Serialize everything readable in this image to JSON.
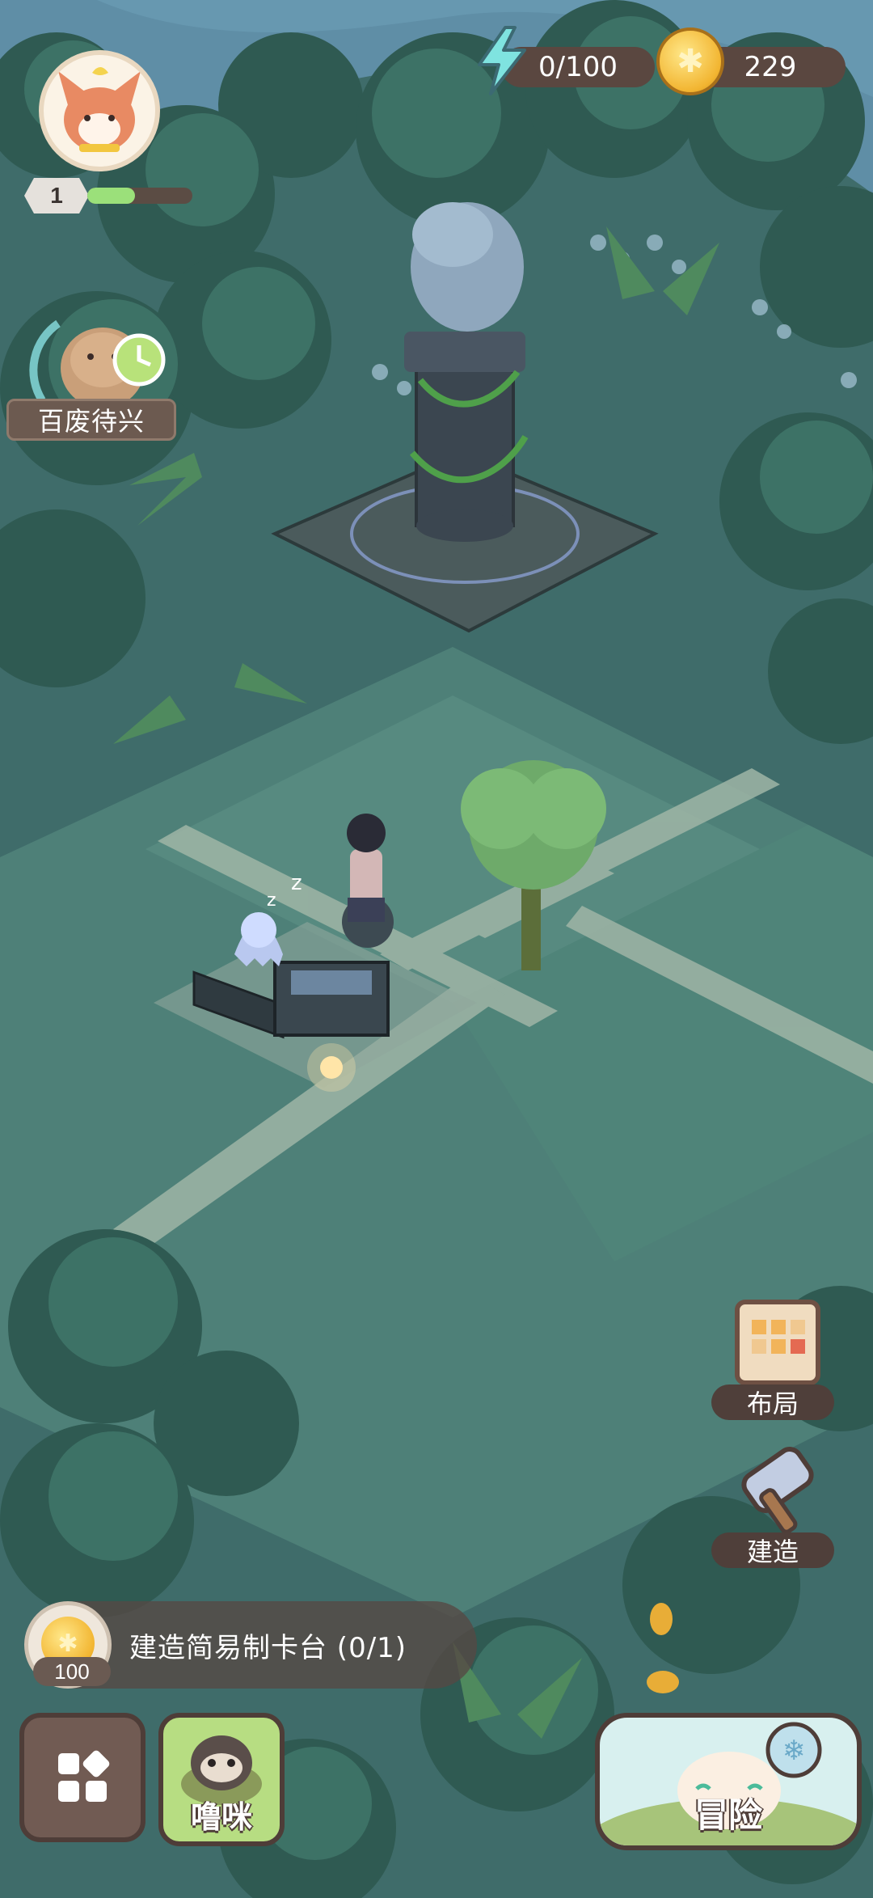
{
  "player": {
    "level": "1",
    "exp_fraction": 0.45
  },
  "resources": {
    "energy": "0/100",
    "coins": "229"
  },
  "quest": {
    "status_label": "百废待兴"
  },
  "side_buttons": {
    "layout_label": "布局",
    "build_label": "建造"
  },
  "task": {
    "text": "建造简易制卡台 (0/1)",
    "cost": "100"
  },
  "bottom": {
    "pet_label": "噜咪",
    "adventure_label": "冒险"
  },
  "colors": {
    "ground": "#3f6c6a",
    "path": "#9fb5a6",
    "ui_brown": "#5a4740",
    "energy": "#7fe3e0",
    "coin": "#f2b531"
  },
  "icons": [
    "lightning-icon",
    "coin-icon",
    "clock-icon",
    "scroll-map-icon",
    "hammer-icon",
    "grid-menu-icon",
    "snowflake-icon"
  ]
}
